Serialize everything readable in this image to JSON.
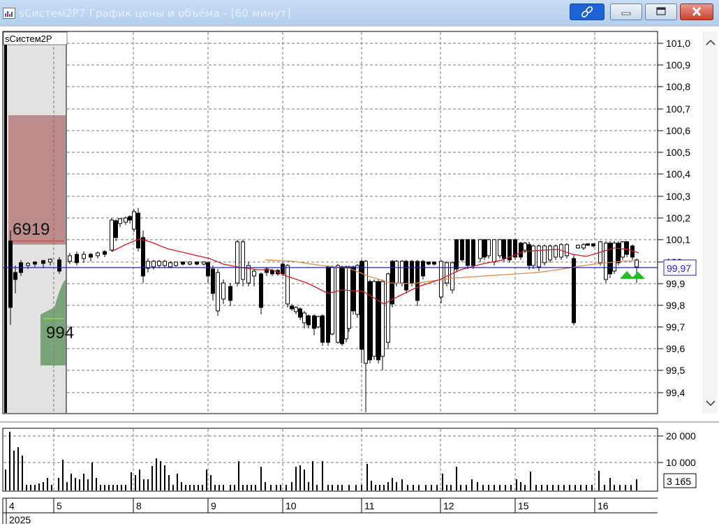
{
  "window": {
    "title": "sСистем2P7 График цены и объёма - [60 минут]"
  },
  "price_panel": {
    "label": "sСистем2P",
    "last_price": "99,97",
    "bid_volume": "6919",
    "ask_volume": "994",
    "y_ticks": [
      "101,0",
      "100,9",
      "100,8",
      "100,7",
      "100,6",
      "100,5",
      "100,4",
      "100,3",
      "100,2",
      "100,1",
      "100",
      "99,9",
      "99,8",
      "99,7",
      "99,6",
      "99,5",
      "99,4"
    ]
  },
  "volume_panel": {
    "y_ticks": [
      "20 000",
      "10 000"
    ],
    "last_volume": "3 165"
  },
  "date_axis": {
    "year": "2025",
    "days": [
      "4",
      "5",
      "8",
      "9",
      "10",
      "11",
      "12",
      "15",
      "16"
    ]
  },
  "colors": {
    "price_line": "#1f1fbf",
    "ma_fast": "#d81b1b",
    "ma_slow": "#e8843c",
    "bid_zone": "#c08080",
    "ask_zone": "#6fa06f",
    "signal": "#22bb22"
  },
  "icons": [
    "chart-app-icon",
    "link-icon",
    "minimize-icon",
    "maximize-icon",
    "close-icon",
    "scroll-up-icon",
    "scroll-down-icon"
  ]
}
